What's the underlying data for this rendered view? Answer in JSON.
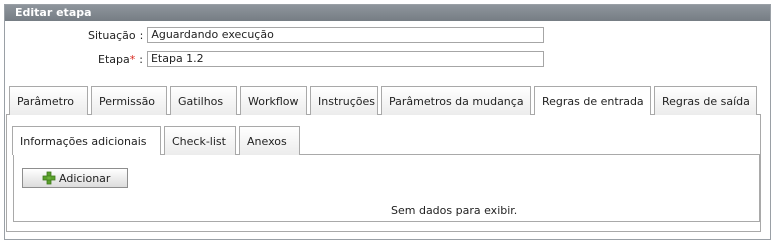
{
  "panel": {
    "title": "Editar etapa"
  },
  "fields": {
    "situacao": {
      "label": "Situação",
      "separator": ":",
      "value": "Aguardando execução"
    },
    "etapa": {
      "label": "Etapa",
      "required_mark": "*",
      "separator": ":",
      "value": "Etapa 1.2"
    }
  },
  "tabs": [
    {
      "label": "Parâmetro"
    },
    {
      "label": "Permissão"
    },
    {
      "label": "Gatilhos"
    },
    {
      "label": "Workflow"
    },
    {
      "label": "Instruções"
    },
    {
      "label": "Parâmetros da mudança"
    },
    {
      "label": "Regras de entrada",
      "active": true
    },
    {
      "label": "Regras de saída"
    }
  ],
  "inner_tabs": [
    {
      "label": "Informações adicionais",
      "active": true
    },
    {
      "label": "Check-list"
    },
    {
      "label": "Anexos"
    }
  ],
  "toolbar": {
    "add_label": "Adicionar",
    "add_icon": "plus-icon"
  },
  "grid": {
    "empty_message": "Sem dados para exibir."
  },
  "colors": {
    "header_bg": "#7f868d",
    "required": "#d8261c",
    "plus_icon": "#5aa02c"
  }
}
